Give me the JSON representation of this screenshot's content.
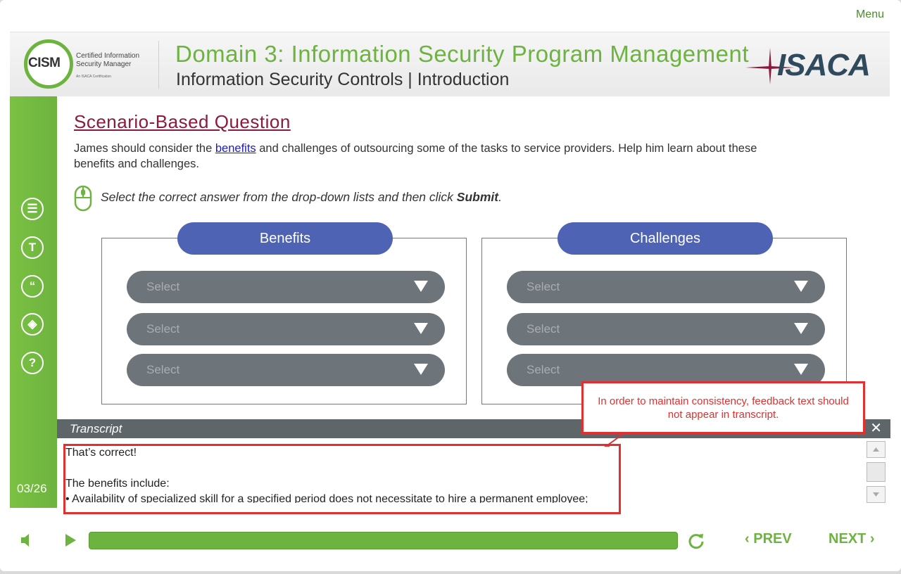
{
  "menu_label": "Menu",
  "header": {
    "cism_logo_text": "CISM",
    "cism_subtitle_line1": "Certified Information",
    "cism_subtitle_line2": "Security Manager",
    "cism_tagline": "An ISACA Certification",
    "domain_title": "Domain 3: Information Security Program Management",
    "subtitle": "Information Security Controls | Introduction",
    "isaca_logo_text": "ISACA"
  },
  "sidebar": {
    "icons": [
      "notes-icon",
      "glossary-icon",
      "quote-icon",
      "layers-icon",
      "help-icon"
    ],
    "icon_glyphs": [
      "☰",
      "T",
      "“",
      "◈",
      "?"
    ],
    "page_counter": "03/26"
  },
  "question": {
    "title": "Scenario-Based Question",
    "text_before": "James should consider the ",
    "link_text": "benefits",
    "text_after": " and challenges of outsourcing some of the tasks to service providers. Help him learn about these benefits and challenges.",
    "instruction_prefix": "Select the correct answer from the drop-down lists and then click ",
    "instruction_bold": "Submit",
    "instruction_suffix": "."
  },
  "panels": {
    "benefits": {
      "header": "Benefits",
      "selects": [
        "Select",
        "Select",
        "Select"
      ]
    },
    "challenges": {
      "header": "Challenges",
      "selects": [
        "Select",
        "Select",
        "Select"
      ]
    }
  },
  "transcript": {
    "label": "Transcript",
    "close_glyph": "✕",
    "line1": "That’s correct!",
    "line2": "The benefits include:",
    "line3": "•  Availability of specialized skill for a specified period does not necessitate to hire a permanent employee;"
  },
  "callout": {
    "text": "In order to maintain consistency, feedback text should not appear in transcript."
  },
  "controls": {
    "prev_label": "PREV",
    "next_label": "NEXT",
    "progress_fraction": 1.0
  },
  "colors": {
    "brand_green": "#6db33f",
    "title_maroon": "#8b1a3f",
    "pill_blue": "#4e63b3",
    "select_gray": "#6d747a",
    "callout_red": "#e03030"
  }
}
